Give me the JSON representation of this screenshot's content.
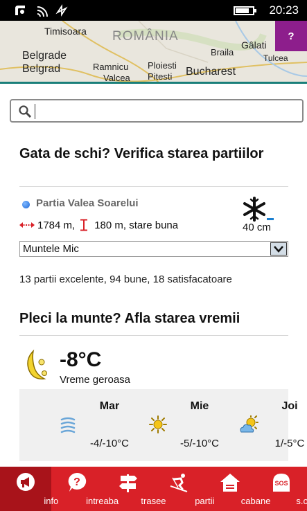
{
  "status_bar": {
    "time": "20:23",
    "battery_level": 0.8
  },
  "map": {
    "labels": [
      "Timisoara",
      "ROMÂNIA",
      "Belgrade",
      "Belgrad",
      "Ramnicu",
      "Valcea",
      "Ploiesti",
      "Pitesti",
      "Bucharest",
      "Braila",
      "Gâlati",
      "Tulcea"
    ],
    "help_label": "?"
  },
  "search": {
    "placeholder": "",
    "value": ""
  },
  "ski": {
    "heading": "Gata de schi? Verifica starea partiilor",
    "piste_name": "Partia Valea Soarelui",
    "length": "1784 m,",
    "elevation_status": "180 m, stare buna",
    "snow_depth": "40 cm",
    "selected_area": "Muntele Mic",
    "summary": "13 partii excelente, 94 bune, 18 satisfacatoare"
  },
  "weather": {
    "heading": "Pleci la munte? Afla starea vremii",
    "current_temp": "-8°C",
    "current_desc": "Vreme geroasa",
    "current_icon": "moon-cloud-icon",
    "forecast": [
      {
        "day": "Mar",
        "temp": "-4/-10°C",
        "icon": "fog-icon"
      },
      {
        "day": "Mie",
        "temp": "-5/-10°C",
        "icon": "sun-icon"
      },
      {
        "day": "Joi",
        "temp": "1/-5°C",
        "icon": "sun-cloud-icon"
      }
    ]
  },
  "nav": [
    {
      "label": "info",
      "icon": "megaphone-icon",
      "active": true
    },
    {
      "label": "intreaba",
      "icon": "question-bubble-icon",
      "active": false
    },
    {
      "label": "trasee",
      "icon": "signpost-icon",
      "active": false
    },
    {
      "label": "partii",
      "icon": "skier-icon",
      "active": false
    },
    {
      "label": "cabane",
      "icon": "cabin-icon",
      "active": false
    },
    {
      "label": "s.o.s.",
      "icon": "sos-icon",
      "active": false
    }
  ],
  "colors": {
    "nav_red": "#d92128",
    "nav_active": "#a8131a",
    "help_purple": "#8d1e8c",
    "accent_teal": "#1a7f7a"
  }
}
